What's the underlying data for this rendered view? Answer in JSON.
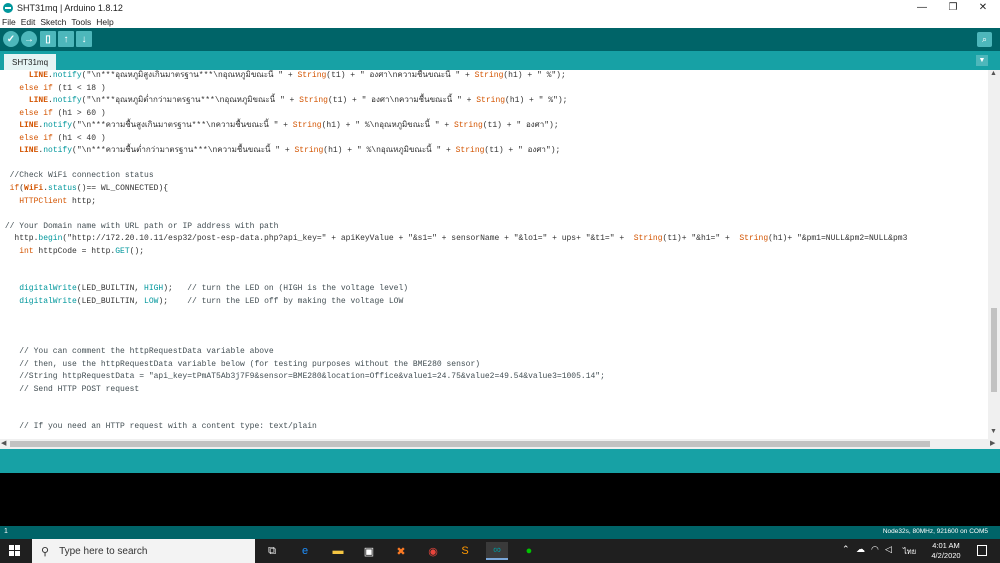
{
  "window": {
    "title": "SHT31mq | Arduino 1.8.12",
    "controls": {
      "minimize": "—",
      "maximize": "❐",
      "close": "✕"
    }
  },
  "menu": [
    "File",
    "Edit",
    "Sketch",
    "Tools",
    "Help"
  ],
  "toolbar": {
    "verify_icon": "check-icon",
    "upload_icon": "arrow-right-icon",
    "new_icon": "new-file-icon",
    "open_icon": "arrow-up-icon",
    "save_icon": "arrow-down-icon",
    "serial_monitor_icon": "magnifier-icon"
  },
  "tabs": [
    {
      "label": "SHT31mq"
    }
  ],
  "code_lines": [
    "      LINE.notify(\"\\n***อุณหภูมิสูงเกินมาตรฐาน***\\nอุณหภูมิขณะนี้ \" + String(t1) + \" องศา\\nความชื้นขณะนี้ \" + String(h1) + \" %\");",
    "    else if (t1 < 18 )",
    "      LINE.notify(\"\\n***อุณหภูมิต่ำกว่ามาตรฐาน***\\nอุณหภูมิขณะนี้ \" + String(t1) + \" องศา\\nความชื้นขณะนี้ \" + String(h1) + \" %\");",
    "    else if (h1 > 60 )",
    "    LINE.notify(\"\\n***ความชื้นสูงเกินมาตรฐาน***\\nความชื้นขณะนี้ \" + String(h1) + \" %\\nอุณหภูมิขณะนี้ \" + String(t1) + \" องศา\");",
    "    else if (h1 < 40 )",
    "    LINE.notify(\"\\n***ความชื้นต่ำกว่ามาตรฐาน***\\nความชื้นขณะนี้ \" + String(h1) + \" %\\nอุณหภูมิขณะนี้ \" + String(t1) + \" องศา\");",
    "",
    "  //Check WiFi connection status",
    "  if(WiFi.status()== WL_CONNECTED){",
    "    HTTPClient http;",
    "",
    " // Your Domain name with URL path or IP address with path",
    "   http.begin(\"http://172.20.10.11/esp32/post-esp-data.php?api_key=\" + apiKeyValue + \"&s1=\" + sensorName + \"&lo1=\" + ups+ \"&t1=\" +  String(t1)+ \"&h1=\" +  String(h1)+ \"&pm1=NULL&pm2=NULL&pm3",
    "    int httpCode = http.GET();",
    "",
    "",
    "    digitalWrite(LED_BUILTIN, HIGH);   // turn the LED on (HIGH is the voltage level)",
    "    digitalWrite(LED_BUILTIN, LOW);    // turn the LED off by making the voltage LOW",
    "",
    "",
    "",
    "    // You can comment the httpRequestData variable above",
    "    // then, use the httpRequestData variable below (for testing purposes without the BME280 sensor)",
    "    //String httpRequestData = \"api_key=tPmAT5Ab3j7F9&sensor=BME280&location=Office&value1=24.75&value2=49.54&value3=1005.14\";",
    "    // Send HTTP POST request",
    "",
    "",
    "    // If you need an HTTP request with a content type: text/plain"
  ],
  "status": {
    "line_number": "1",
    "board": "Node32s, 80MHz, 921600 on COM5"
  },
  "taskbar": {
    "search_placeholder": "Type here to search",
    "apps": [
      "task-view-icon",
      "edge-icon",
      "file-explorer-icon",
      "store-icon",
      "xampp-icon",
      "chrome-icon",
      "sublime-icon",
      "arduino-icon",
      "line-icon"
    ],
    "language": "ไทย",
    "time": "4:01 AM",
    "date": "4/2/2020"
  },
  "colors": {
    "toolbar": "#006468",
    "tabbar": "#17a1a5",
    "button": "#4db7bb",
    "keyword": "#d35400",
    "function": "#00979c",
    "comment": "#434f54"
  }
}
